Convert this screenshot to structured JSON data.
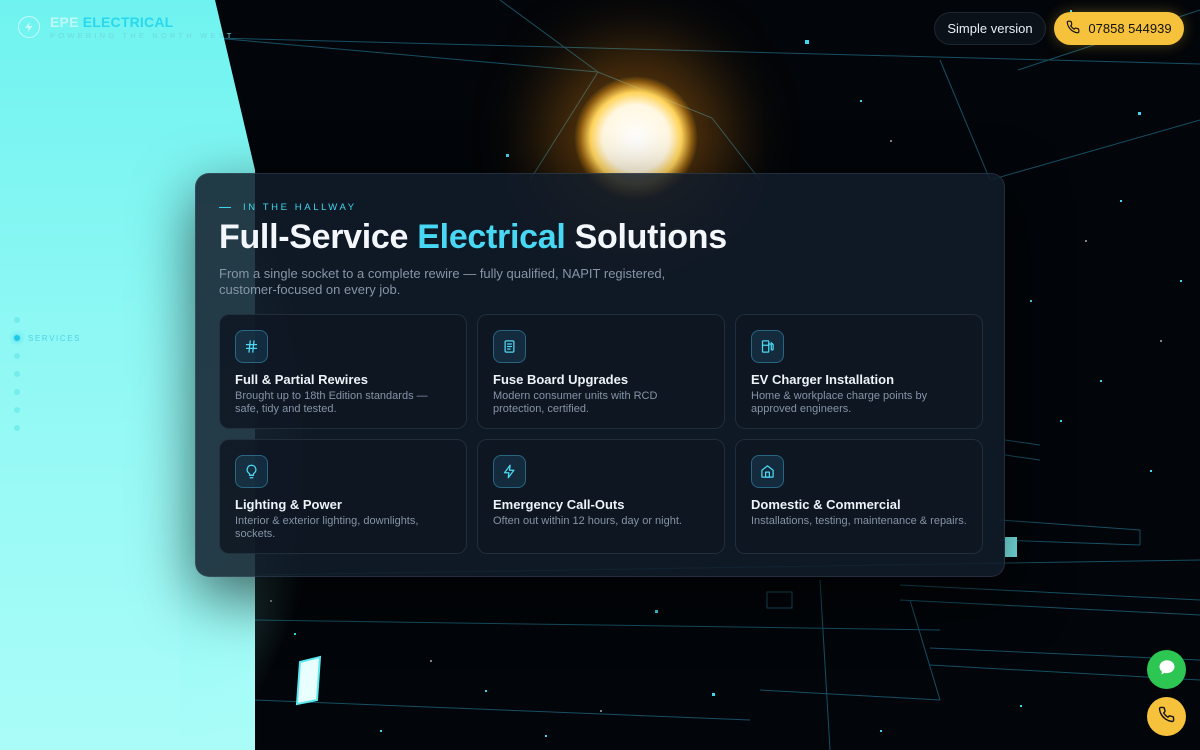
{
  "header": {
    "brand_part1": "EPE",
    "brand_part2": "ELECTRICAL",
    "tagline": "POWERING THE NORTH WEST",
    "simple_version_label": "Simple version",
    "phone_label": "07858 544939"
  },
  "sidenav": {
    "active_label": "SERVICES",
    "dots": 7,
    "active_index": 1
  },
  "section": {
    "eyebrow": "IN THE HALLWAY",
    "title_before": "Full-Service ",
    "title_highlight": "Electrical",
    "title_after": " Solutions",
    "subtitle": "From a single socket to a complete rewire — fully qualified, NAPIT registered, customer-focused on every job."
  },
  "services": [
    {
      "icon": "hash-icon",
      "title": "Full & Partial Rewires",
      "desc": "Brought up to 18th Edition standards — safe, tidy and tested."
    },
    {
      "icon": "document-icon",
      "title": "Fuse Board Upgrades",
      "desc": "Modern consumer units with RCD protection, certified."
    },
    {
      "icon": "fuel-pump-icon",
      "title": "EV Charger Installation",
      "desc": "Home & workplace charge points by approved engineers."
    },
    {
      "icon": "lightbulb-icon",
      "title": "Lighting & Power",
      "desc": "Interior & exterior lighting, downlights, sockets."
    },
    {
      "icon": "lightning-icon",
      "title": "Emergency Call-Outs",
      "desc": "Often out within 12 hours, day or night."
    },
    {
      "icon": "home-icon",
      "title": "Domestic & Commercial",
      "desc": "Installations, testing, maintenance & repairs."
    }
  ],
  "colors": {
    "accent": "#48d8f3",
    "phone_button": "#f7c23b",
    "chat_button": "#2dc653",
    "wall": "#8ff8f4"
  }
}
